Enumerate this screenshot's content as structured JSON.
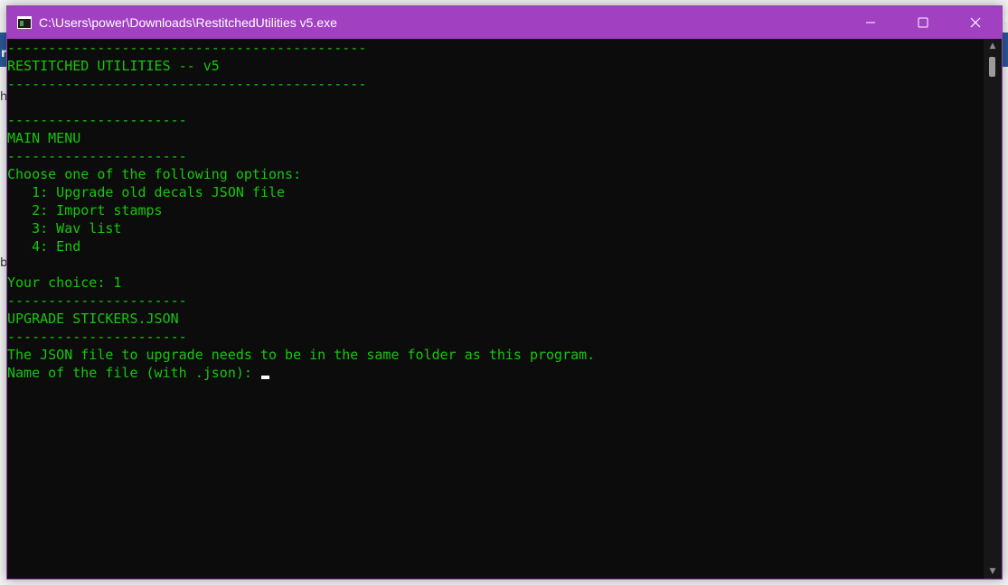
{
  "background": {
    "fragments": [
      "r",
      "h",
      "b",
      "N"
    ]
  },
  "window": {
    "title": "C:\\Users\\power\\Downloads\\RestitchedUtilities v5.exe",
    "icon": "console-app-icon",
    "controls": {
      "minimize": "minimize-icon",
      "maximize": "maximize-icon",
      "close": "close-icon"
    },
    "accent_color": "#a240c2"
  },
  "console": {
    "text_color": "#16c60c",
    "lines": [
      "--------------------------------------------",
      "RESTITCHED UTILITIES -- v5",
      "--------------------------------------------",
      "",
      "----------------------",
      "MAIN MENU",
      "----------------------",
      "Choose one of the following options:",
      "   1: Upgrade old decals JSON file",
      "   2: Import stamps",
      "   3: Wav list",
      "   4: End",
      "",
      "Your choice: 1",
      "----------------------",
      "UPGRADE STICKERS.JSON",
      "----------------------",
      "The JSON file to upgrade needs to be in the same folder as this program.",
      "Name of the file (with .json): "
    ]
  }
}
